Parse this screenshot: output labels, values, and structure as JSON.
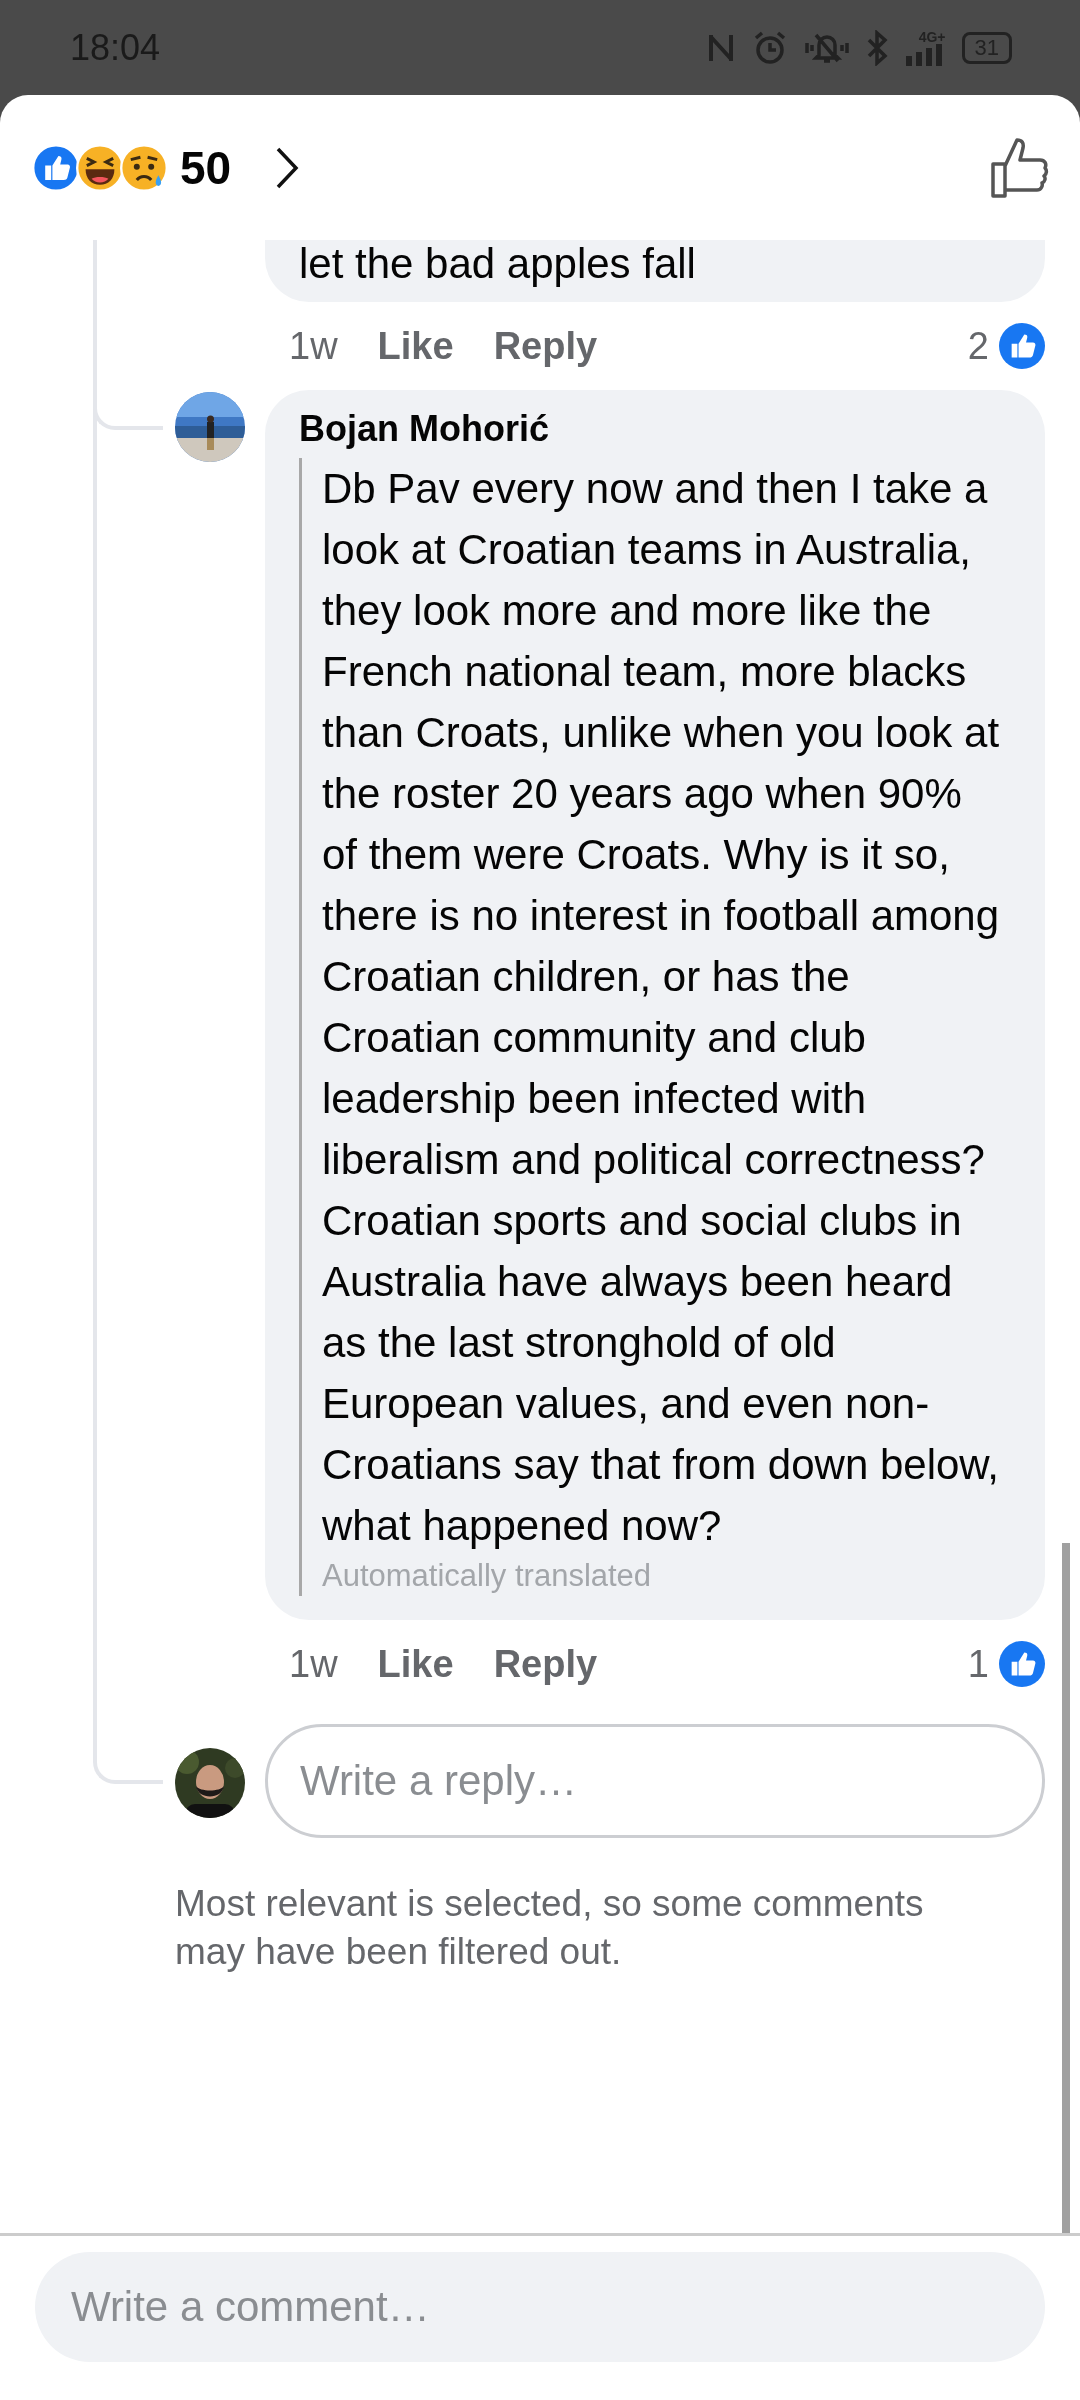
{
  "status_bar": {
    "time": "18:04",
    "network": "4G+",
    "battery": "31"
  },
  "header": {
    "reaction_count": "50"
  },
  "comments": [
    {
      "text": "let the bad apples fall",
      "time": "1w",
      "like_label": "Like",
      "reply_label": "Reply",
      "like_count": "2"
    },
    {
      "author": "Bojan Mohorić",
      "text": "Db Pav every now and then I take a look at Croatian teams in Australia, they look more and more like the French national team, more blacks than Croats, unlike when you look at the roster 20 years ago when 90% of them were Croats. Why is it so, there is no interest in football among Croatian children, or has the Croatian community and club leadership been infected with liberalism and political correctness? Croatian sports and social clubs in Australia have always been heard as the last stronghold of old European values, and even non-Croatians say that from down below, what happened now?",
      "translation_note": "Automatically translated",
      "time": "1w",
      "like_label": "Like",
      "reply_label": "Reply",
      "like_count": "1"
    }
  ],
  "reply_field": {
    "placeholder": "Write a reply…"
  },
  "filter_notice": "Most relevant is selected, so some comments may have been filtered out.",
  "comment_field": {
    "placeholder": "Write a comment…"
  }
}
